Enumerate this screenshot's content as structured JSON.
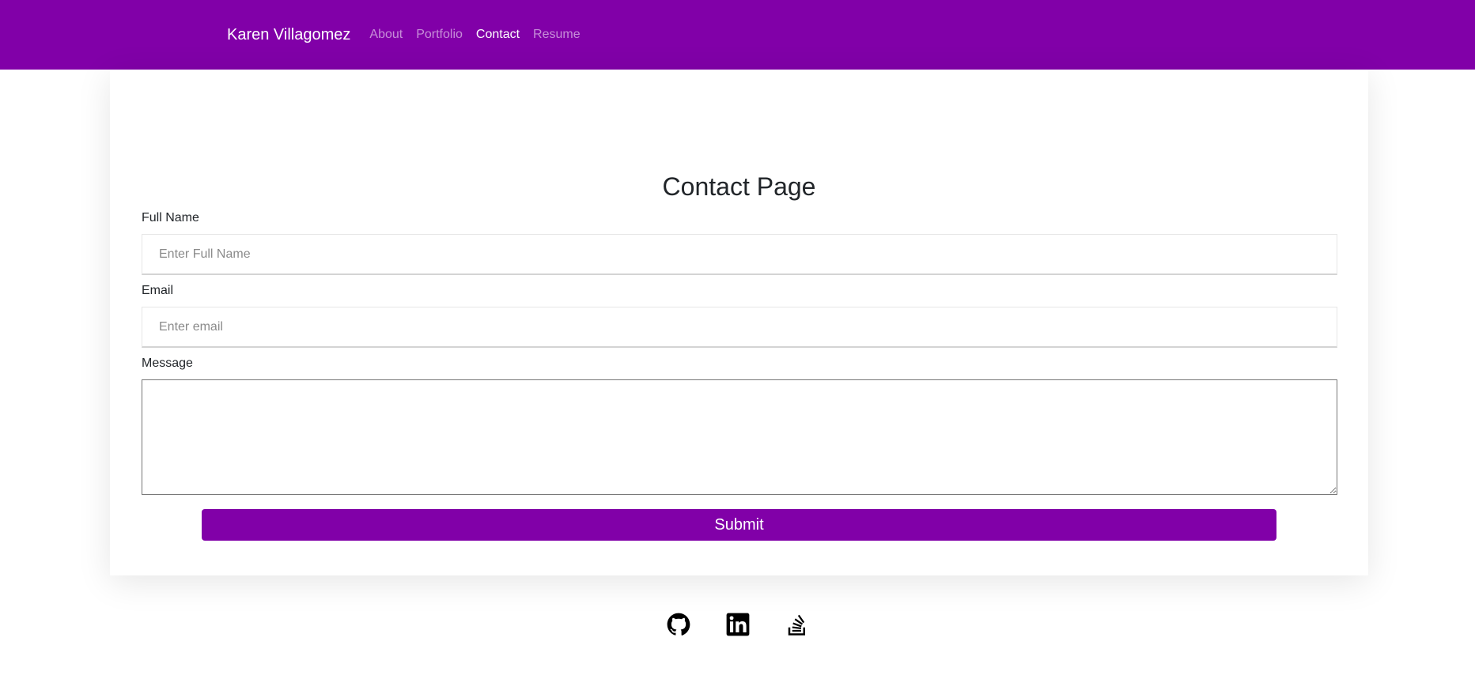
{
  "navbar": {
    "brand": "Karen Villagomez",
    "links": [
      {
        "label": "About",
        "active": false
      },
      {
        "label": "Portfolio",
        "active": false
      },
      {
        "label": "Contact",
        "active": true
      },
      {
        "label": "Resume",
        "active": false
      }
    ]
  },
  "page": {
    "title": "Contact Page"
  },
  "form": {
    "full_name_label": "Full Name",
    "full_name_placeholder": "Enter Full Name",
    "full_name_value": "",
    "email_label": "Email",
    "email_placeholder": "Enter email",
    "email_value": "",
    "message_label": "Message",
    "message_value": "",
    "submit_label": "Submit"
  },
  "footer": {
    "icons": [
      "github-icon",
      "linkedin-icon",
      "stackoverflow-icon"
    ]
  },
  "colors": {
    "brand": "#8100a8",
    "text": "#212529"
  }
}
